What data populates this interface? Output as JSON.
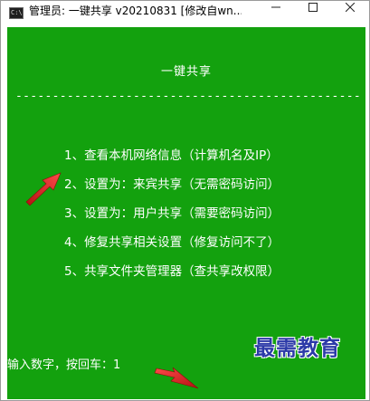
{
  "window": {
    "title": "管理员: 一键共享 v20210831 [修改自wn...",
    "icon_label": "C:\\",
    "controls": {
      "minimize": "minimize-icon",
      "maximize": "maximize-icon",
      "close": "close-icon"
    }
  },
  "console": {
    "heading": "一键共享",
    "divider": "------------------------------------------------",
    "menu": [
      "1、查看本机网络信息（计算机名及IP）",
      "2、设置为：来宾共享（无需密码访问）",
      "3、设置为：用户共享（需要密码访问）",
      "4、修复共享相关设置（修复访问不了）",
      "5、共享文件夹管理器（查共享改权限）"
    ],
    "prompt": "输入数字，按回车：1"
  },
  "watermark": "最需教育",
  "colors": {
    "console_bg": "#13a10e",
    "console_text": "#ffffff",
    "arrow": "#e21b1b",
    "watermark": "#2c3aa8"
  }
}
